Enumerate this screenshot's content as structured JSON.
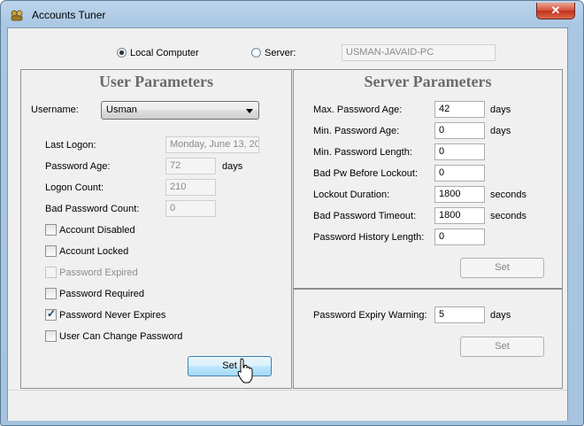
{
  "window": {
    "title": "Accounts Tuner",
    "close_glyph": "✕"
  },
  "target": {
    "local_label": "Local Computer",
    "server_label": "Server:",
    "server_value": "USMAN-JAVAID-PC",
    "selected": "local"
  },
  "user": {
    "title": "User Parameters",
    "username_label": "Username:",
    "username_value": "Usman",
    "last_logon_label": "Last Logon:",
    "last_logon_value": "Monday, June 13, 20",
    "password_age_label": "Password Age:",
    "password_age_value": "72",
    "password_age_unit": "days",
    "logon_count_label": "Logon Count:",
    "logon_count_value": "210",
    "bad_password_count_label": "Bad Password Count:",
    "bad_password_count_value": "0",
    "checkboxes": [
      {
        "label": "Account Disabled",
        "checked": false,
        "enabled": true
      },
      {
        "label": "Account Locked",
        "checked": false,
        "enabled": true
      },
      {
        "label": "Password Expired",
        "checked": false,
        "enabled": false
      },
      {
        "label": "Password Required",
        "checked": false,
        "enabled": true
      },
      {
        "label": "Password Never Expires",
        "checked": true,
        "enabled": true
      },
      {
        "label": "User Can Change Password",
        "checked": false,
        "enabled": true
      }
    ],
    "set_label": "Set"
  },
  "server": {
    "title": "Server Parameters",
    "fields": [
      {
        "label": "Max. Password Age:",
        "value": "42",
        "unit": "days"
      },
      {
        "label": "Min. Password Age:",
        "value": "0",
        "unit": "days"
      },
      {
        "label": "Min. Password Length:",
        "value": "0",
        "unit": ""
      },
      {
        "label": "Bad Pw Before Lockout:",
        "value": "0",
        "unit": ""
      },
      {
        "label": "Lockout Duration:",
        "value": "1800",
        "unit": "seconds"
      },
      {
        "label": "Bad Password Timeout:",
        "value": "1800",
        "unit": "seconds"
      },
      {
        "label": "Password History Length:",
        "value": "0",
        "unit": ""
      }
    ],
    "set_label": "Set",
    "expiry_warning_label": "Password Expiry Warning:",
    "expiry_warning_value": "5",
    "expiry_warning_unit": "days",
    "expiry_set_label": "Set"
  }
}
